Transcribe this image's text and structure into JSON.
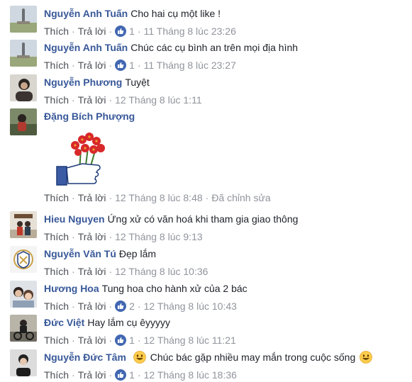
{
  "actions": {
    "like": "Thích",
    "reply": "Trả lời",
    "separator": "·"
  },
  "colors": {
    "name": "#385898",
    "action": "#4b4f56",
    "meta": "#90949c",
    "text": "#1d2129",
    "like_badge": "#4267b2"
  },
  "comments": [
    {
      "name": "Nguyễn Anh Tuấn",
      "text": "Cho hai cụ một like !",
      "likes": "1",
      "time": "11 Tháng 8 lúc 23:26",
      "avatar": "statue-photo"
    },
    {
      "name": "Nguyễn Anh Tuấn",
      "text": "Chúc các cụ bình an trên mọi địa hình",
      "likes": "1",
      "time": "11 Tháng 8 lúc 23:27",
      "avatar": "statue-photo"
    },
    {
      "name": "Nguyễn Phương",
      "text": "Tuyệt",
      "time": "12 Tháng 8 lúc 1:11",
      "avatar": "portrait-photo"
    },
    {
      "name": "Đặng Bích Phượng",
      "text": "",
      "time": "12 Tháng 8 lúc 8:48",
      "edited": "Đã chỉnh sửa",
      "avatar": "outdoor-photo",
      "sticker": "thumbs-up-flowers-sticker"
    },
    {
      "name": "Hieu Nguyen",
      "text": "Ứng xử có văn hoá khi tham gia giao thông",
      "time": "12 Tháng 8 lúc 9:13",
      "avatar": "group-photo"
    },
    {
      "name": "Nguyễn Văn Tú",
      "text": "Đẹp lắm",
      "time": "12 Tháng 8 lúc 10:36",
      "avatar": "crest-logo"
    },
    {
      "name": "Hương Hoa",
      "text": "Tung hoa cho hành xử của 2 bác",
      "likes": "2",
      "time": "12 Tháng 8 lúc 10:43",
      "avatar": "mother-child-photo"
    },
    {
      "name": "Đức Việt",
      "text": "Hay lắm cụ êyyyyy",
      "likes": "1",
      "time": "12 Tháng 8 lúc 11:21",
      "avatar": "motorbike-photo"
    },
    {
      "name": "Nguyễn Đức Tâm",
      "text": "Chúc bác gặp nhiều may mắn trong cuộc sống",
      "likes": "1",
      "time": "12 Tháng 8 lúc 18:36",
      "avatar": "young-man-photo",
      "emoji": "smiley-icon"
    }
  ]
}
